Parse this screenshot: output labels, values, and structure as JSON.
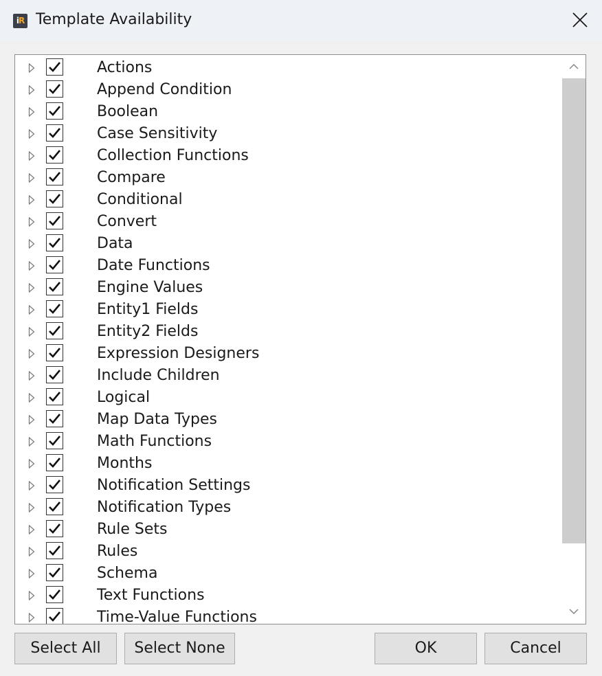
{
  "window": {
    "title": "Template Availability",
    "app_icon_text": "iR",
    "close_icon": "close-icon"
  },
  "tree": {
    "items": [
      {
        "label": "Actions",
        "checked": true
      },
      {
        "label": "Append Condition",
        "checked": true
      },
      {
        "label": "Boolean",
        "checked": true
      },
      {
        "label": "Case Sensitivity",
        "checked": true
      },
      {
        "label": "Collection Functions",
        "checked": true
      },
      {
        "label": "Compare",
        "checked": true
      },
      {
        "label": "Conditional",
        "checked": true
      },
      {
        "label": "Convert",
        "checked": true
      },
      {
        "label": "Data",
        "checked": true
      },
      {
        "label": "Date Functions",
        "checked": true
      },
      {
        "label": "Engine Values",
        "checked": true
      },
      {
        "label": "Entity1 Fields",
        "checked": true
      },
      {
        "label": "Entity2 Fields",
        "checked": true
      },
      {
        "label": "Expression Designers",
        "checked": true
      },
      {
        "label": "Include Children",
        "checked": true
      },
      {
        "label": "Logical",
        "checked": true
      },
      {
        "label": "Map Data Types",
        "checked": true
      },
      {
        "label": "Math Functions",
        "checked": true
      },
      {
        "label": "Months",
        "checked": true
      },
      {
        "label": "Notification Settings",
        "checked": true
      },
      {
        "label": "Notification Types",
        "checked": true
      },
      {
        "label": "Rule Sets",
        "checked": true
      },
      {
        "label": "Rules",
        "checked": true
      },
      {
        "label": "Schema",
        "checked": true
      },
      {
        "label": "Text Functions",
        "checked": true
      },
      {
        "label": "Time-Value Functions",
        "checked": true
      }
    ]
  },
  "buttons": {
    "select_all": "Select All",
    "select_none": "Select None",
    "ok": "OK",
    "cancel": "Cancel"
  },
  "colors": {
    "titlebar": "#eef1f6",
    "dialog_background": "#f0f0f0",
    "button_face": "#e1e1e1",
    "scroll_thumb": "#cdcdcd"
  }
}
